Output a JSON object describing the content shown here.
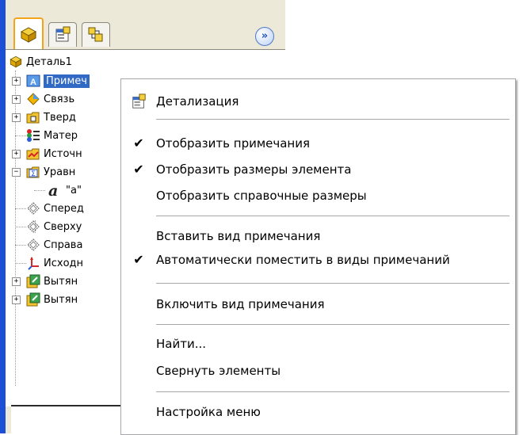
{
  "panel": {
    "tabs": [
      {
        "name": "feature-manager",
        "active": true
      },
      {
        "name": "property-manager",
        "active": false
      },
      {
        "name": "configuration-manager",
        "active": false
      }
    ],
    "expand_glyph": "»",
    "tree": {
      "root": "Деталь1",
      "items": [
        {
          "label": "Примеч",
          "icon": "annotations-icon",
          "selected": true
        },
        {
          "label": "Связь",
          "icon": "link-icon"
        },
        {
          "label": "Тверд",
          "icon": "solid-bodies-icon"
        },
        {
          "label": "Матер",
          "icon": "material-icon"
        },
        {
          "label": "Источн",
          "icon": "lights-icon"
        },
        {
          "label": "Уравн",
          "icon": "equations-icon"
        },
        {
          "label": "\"a\"",
          "icon": "equation-a-icon"
        },
        {
          "label": "Сперед",
          "icon": "plane-icon"
        },
        {
          "label": "Сверху",
          "icon": "plane-icon"
        },
        {
          "label": "Справа",
          "icon": "plane-icon"
        },
        {
          "label": "Исходн",
          "icon": "origin-icon"
        },
        {
          "label": "Вытян",
          "icon": "extrude-icon"
        },
        {
          "label": "Вытян",
          "icon": "extrude-icon"
        }
      ]
    }
  },
  "context_menu": {
    "items": [
      {
        "label": "Детализация",
        "icon": "detailing-icon"
      },
      {
        "label": "Отобразить примечания",
        "checked": true
      },
      {
        "label": "Отобразить размеры элемента",
        "checked": true
      },
      {
        "label": "Отобразить справочные размеры",
        "checked": false
      },
      {
        "label": "Вставить вид примечания",
        "checked": false
      },
      {
        "label": "Автоматически поместить в виды примечаний",
        "checked": true
      },
      {
        "label": "Включить вид примечания",
        "checked": false
      },
      {
        "label": "Найти...",
        "checked": false
      },
      {
        "label": "Свернуть элементы",
        "checked": false
      },
      {
        "label": "Настройка меню",
        "checked": false
      }
    ],
    "check_glyph": "✔"
  },
  "colors": {
    "selection": "#316ac5",
    "active_tab_border": "#f2a51a",
    "window_rail": "#1a4fd6"
  }
}
